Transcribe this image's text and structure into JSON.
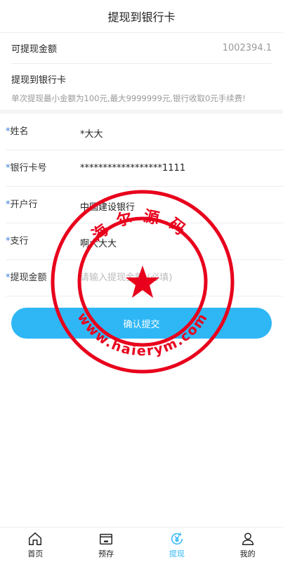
{
  "header": {
    "title": "提现到银行卡"
  },
  "available": {
    "label": "可提现金额",
    "amount": "1002394.1"
  },
  "bank": {
    "title": "提现到银行卡",
    "note": "单次提现最小金额为100元,最大9999999元,银行收取0元手续费!"
  },
  "form": {
    "star": "*",
    "name_label": "姓名",
    "name_value": "*大大",
    "card_label": "银行卡号",
    "card_value": "******************1111",
    "bank_label": "开户行",
    "bank_value": "中国建设银行",
    "branch_label": "支行",
    "branch_value": "啊大大大",
    "amount_label": "提现金额",
    "amount_placeholder": "请输入提现金额 (必填)"
  },
  "submit_label": "确认提交",
  "stamp": {
    "top_text": "海尔源码",
    "bottom_text": "www.haierym.com",
    "color": "#e8001c"
  },
  "tabs": [
    {
      "label": "首页",
      "icon": "home-icon"
    },
    {
      "label": "预存",
      "icon": "wallet-icon"
    },
    {
      "label": "提现",
      "icon": "withdraw-icon"
    },
    {
      "label": "我的",
      "icon": "user-icon"
    }
  ],
  "colors": {
    "accent": "#2fb7f5",
    "star": "#3b7dd8"
  }
}
